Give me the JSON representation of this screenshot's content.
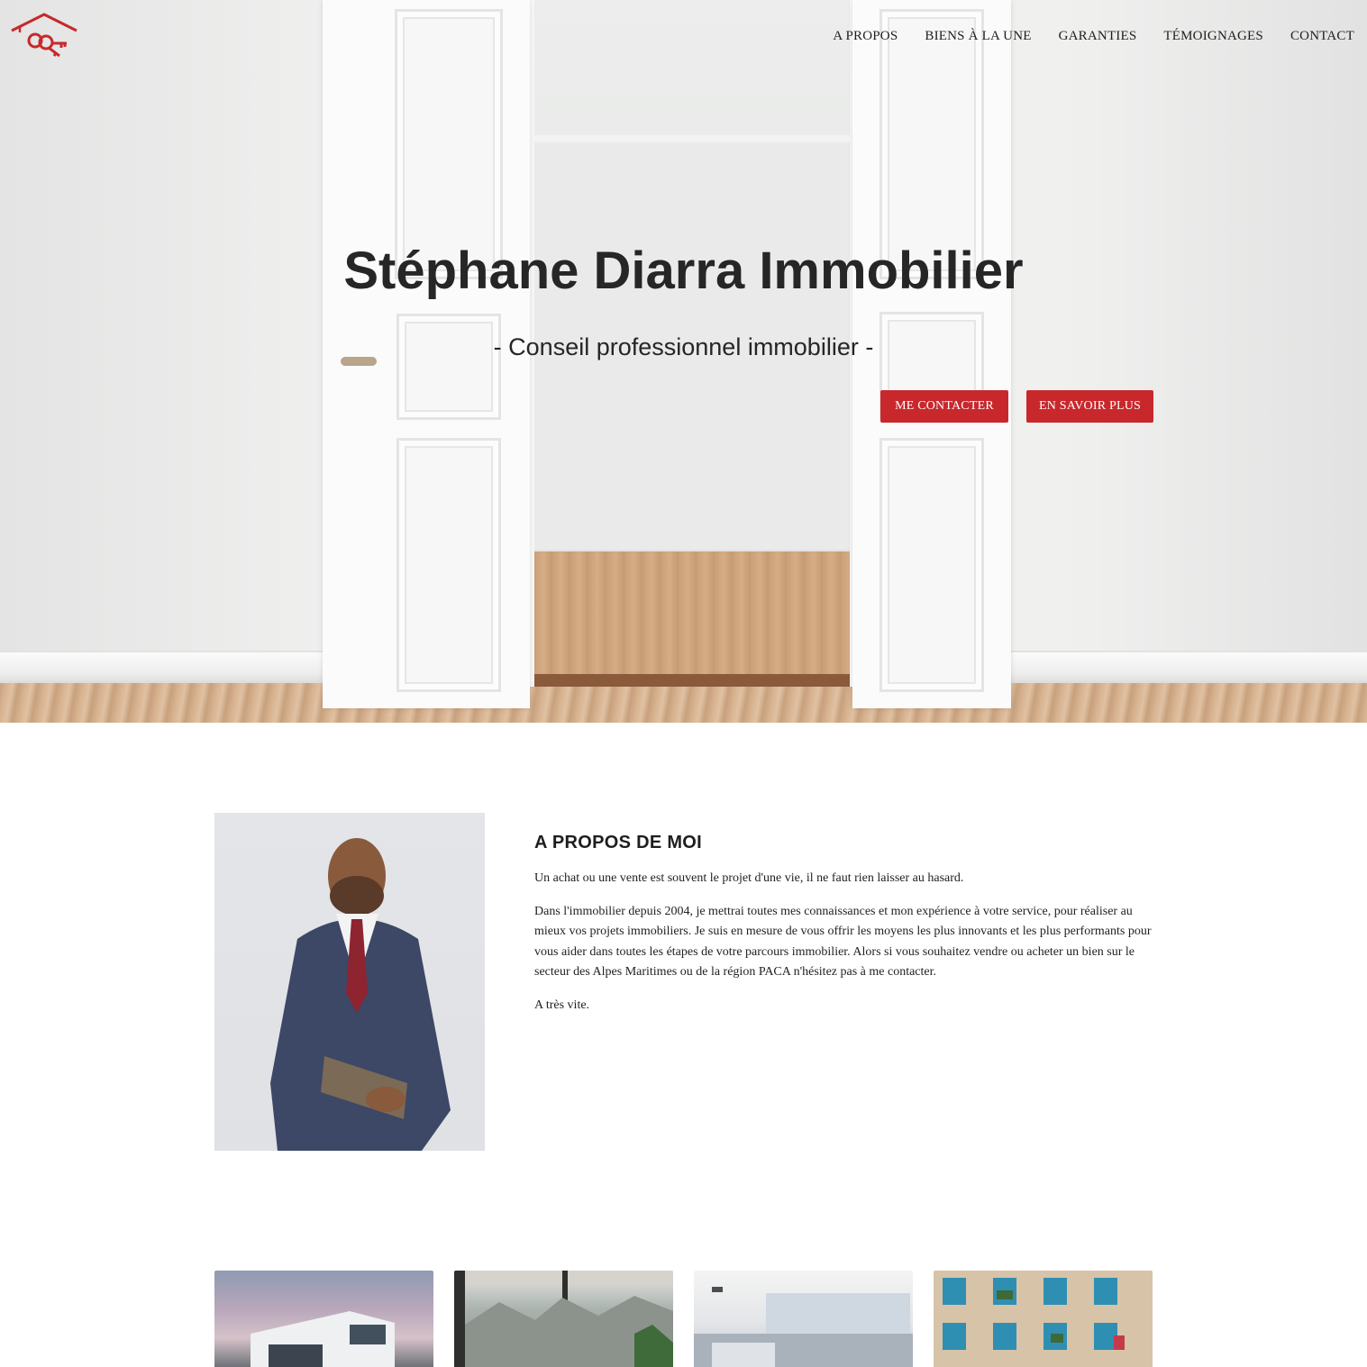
{
  "nav": {
    "items": [
      "A PROPOS",
      "BIENS À LA UNE",
      "GARANTIES",
      "TÉMOIGNAGES",
      "CONTACT"
    ]
  },
  "hero": {
    "title": "Stéphane Diarra Immobilier",
    "subtitle": "- Conseil professionnel immobilier -",
    "contact_button": "ME CONTACTER",
    "more_button": "EN SAVOIR PLUS"
  },
  "about": {
    "title": "A PROPOS DE MOI",
    "paragraphs": [
      "Un achat ou une vente est souvent le projet d'une vie, il ne faut rien laisser au hasard.",
      "Dans l'immobilier depuis 2004, je mettrai toutes mes connaissances et mon expérience à votre service, pour réaliser au mieux vos projets immobiliers. Je suis en mesure de vous offrir les moyens les plus innovants et les plus performants pour vous aider dans toutes les étapes de votre parcours immobilier. Alors si vous souhaitez vendre ou acheter un bien sur le secteur des Alpes Maritimes ou de la région PACA n'hésitez pas à me contacter.",
      "A très vite."
    ]
  },
  "colors": {
    "accent": "#c8282c",
    "text": "#1e1e1e"
  },
  "icons": {
    "logo": "house-key-logo"
  }
}
